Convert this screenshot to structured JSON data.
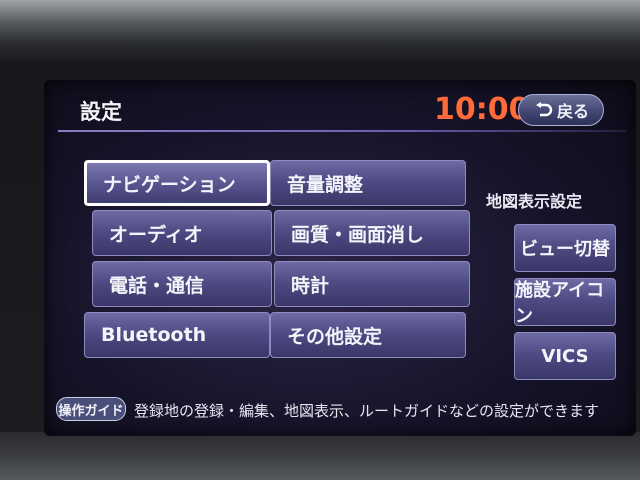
{
  "header": {
    "title": "設定",
    "clock": "10:00",
    "back_label": "戻る"
  },
  "menu": {
    "left": [
      {
        "label": "ナビゲーション",
        "selected": true
      },
      {
        "label": "オーディオ"
      },
      {
        "label": "電話・通信"
      },
      {
        "label": "Bluetooth"
      }
    ],
    "middle": [
      {
        "label": "音量調整"
      },
      {
        "label": "画質・画面消し"
      },
      {
        "label": "時計"
      },
      {
        "label": "その他設定"
      }
    ]
  },
  "map_settings": {
    "label": "地図表示設定",
    "buttons": [
      "ビュー切替",
      "施設アイコン",
      "VICS"
    ]
  },
  "guide": {
    "badge": "操作ガイド",
    "text": "登録地の登録・編集、地図表示、ルートガイドなどの設定ができます"
  },
  "colors": {
    "clock": "#ff6a3a",
    "button": "#4f4b84",
    "screen_bg": "#17142a"
  }
}
